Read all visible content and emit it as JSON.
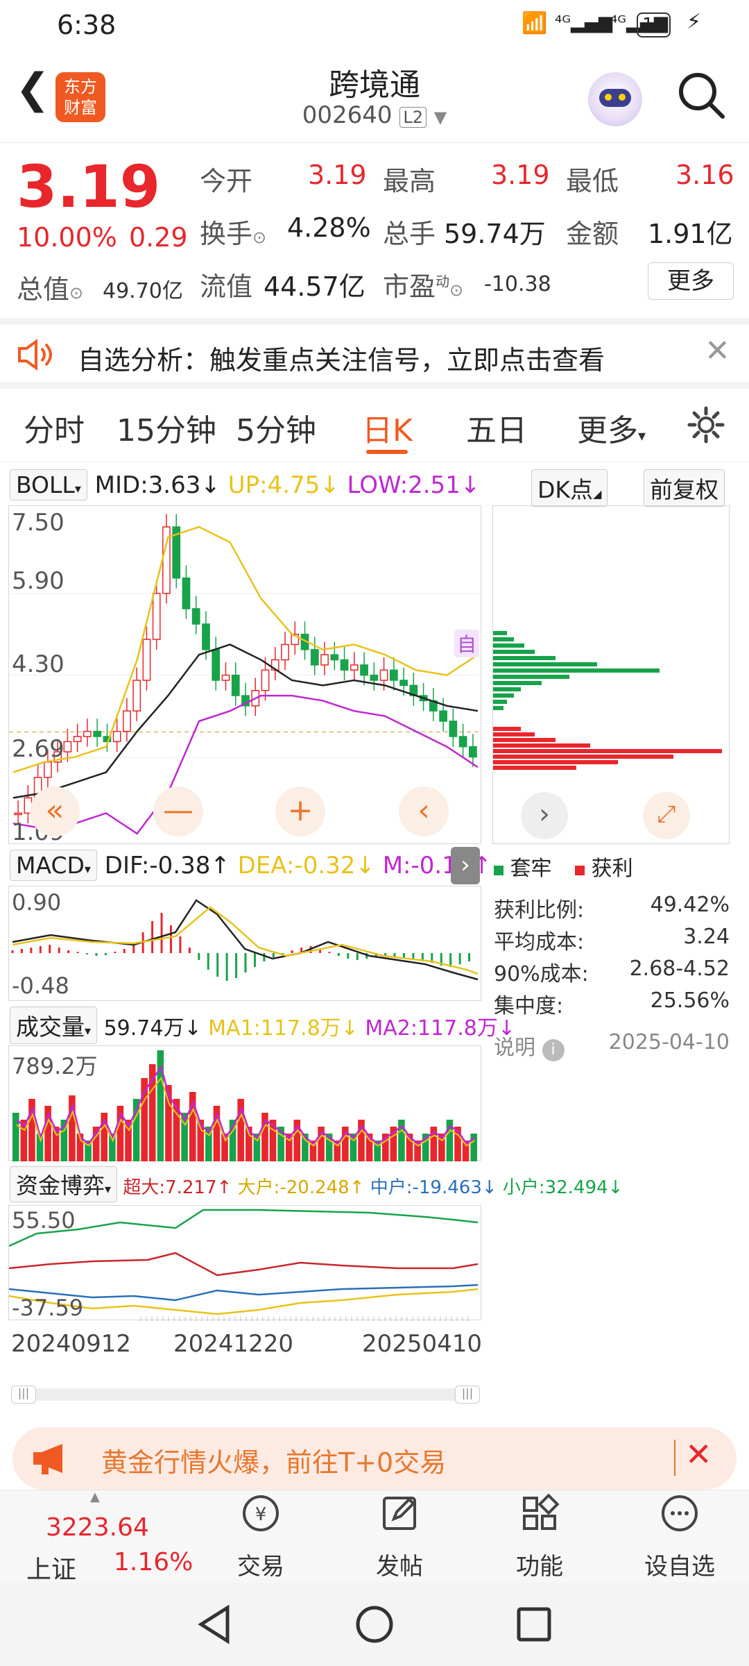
{
  "status": {
    "time": "6:38",
    "battery": "16"
  },
  "header": {
    "title": "跨境通",
    "code": "002640",
    "level": "L2",
    "logo_text": "东方财富"
  },
  "quote": {
    "price": "3.19",
    "change_pct": "10.00%",
    "change": "0.29",
    "total_value_label": "总值",
    "total_value": "49.70亿",
    "open_label": "今开",
    "open": "3.19",
    "high_label": "最高",
    "high": "3.19",
    "low_label": "最低",
    "low": "3.16",
    "turnover_label": "换手",
    "turnover": "4.28%",
    "volume_label": "总手",
    "volume": "59.74万",
    "amount_label": "金额",
    "amount": "1.91亿",
    "float_label": "流值",
    "float_value": "44.57亿",
    "pe_label": "市盈",
    "pe_sup": "动",
    "pe": "-10.38",
    "more": "更多"
  },
  "notice": {
    "text": "自选分析：触发重点关注信号，立即点击查看"
  },
  "tabs": [
    "分时",
    "15分钟",
    "5分钟",
    "日K",
    "五日",
    "更多",
    "▾"
  ],
  "active_tab": "日K",
  "kline": {
    "indicator": "BOLL",
    "mid": "MID:3.63↓",
    "up": "UP:4.75↓",
    "low": "LOW:2.51↓",
    "dk": "DK点",
    "fq": "前复权",
    "y_labels": [
      "7.50",
      "5.90",
      "4.30",
      "2.69",
      "1.09"
    ],
    "self_tag": "自"
  },
  "macd": {
    "indicator": "MACD",
    "dif": "DIF:-0.38↑",
    "dea": "DEA:-0.32↓",
    "m": "M:-0.12↑",
    "y_labels": [
      "0.90",
      "-0.48"
    ]
  },
  "vol": {
    "indicator": "成交量",
    "v": "59.74万↓",
    "ma1": "MA1:117.8万↓",
    "ma2": "MA2:117.8万↓",
    "y_label": "789.2万"
  },
  "fund": {
    "indicator": "资金博弈",
    "super": "超大:7.217↑",
    "big": "大户:-20.248↑",
    "mid": "中户:-19.463↓",
    "small": "小户:32.494↓",
    "y_labels": [
      "55.50",
      "-37.59"
    ]
  },
  "dates": [
    "20240912",
    "20241220",
    "20250410"
  ],
  "chip": {
    "legend_trap": "套牢",
    "legend_profit": "获利",
    "rows": [
      [
        "获利比例:",
        "49.42%"
      ],
      [
        "平均成本:",
        "3.24"
      ],
      [
        "90%成本:",
        "2.68-4.52"
      ],
      [
        "集中度:",
        "25.56%"
      ]
    ],
    "note": "说明",
    "date": "2025-04-10"
  },
  "promo": {
    "text": "黄金行情火爆，前往T+0交易"
  },
  "bottom_nav": {
    "index_value": "3223.64",
    "index_name": "上证",
    "index_pct": "1.16%",
    "items": [
      "交易",
      "发帖",
      "功能",
      "设自选"
    ]
  },
  "colors": {
    "red": "#e8262c",
    "green": "#17a34a",
    "yellow": "#e8c21a",
    "magenta": "#c026d3",
    "accent": "#f05a22"
  },
  "chart_data": {
    "type": "line",
    "title": "",
    "ylim": [
      1.09,
      7.5
    ],
    "series": [
      {
        "name": "MID",
        "values": [
          1.9,
          2.0,
          2.2,
          2.4,
          3.2,
          3.9,
          4.7,
          4.9,
          4.6,
          4.2,
          4.1,
          4.2,
          4.1,
          3.9,
          3.7,
          3.6
        ]
      },
      {
        "name": "UP",
        "values": [
          2.4,
          2.6,
          2.7,
          2.9,
          4.6,
          7.0,
          7.2,
          6.9,
          5.8,
          5.1,
          4.8,
          4.9,
          4.7,
          4.4,
          4.3,
          4.7
        ]
      },
      {
        "name": "LOW",
        "values": [
          1.4,
          1.3,
          1.4,
          1.6,
          1.2,
          2.0,
          3.4,
          3.6,
          3.9,
          3.9,
          3.8,
          3.6,
          3.5,
          3.2,
          2.9,
          2.5
        ]
      }
    ]
  }
}
